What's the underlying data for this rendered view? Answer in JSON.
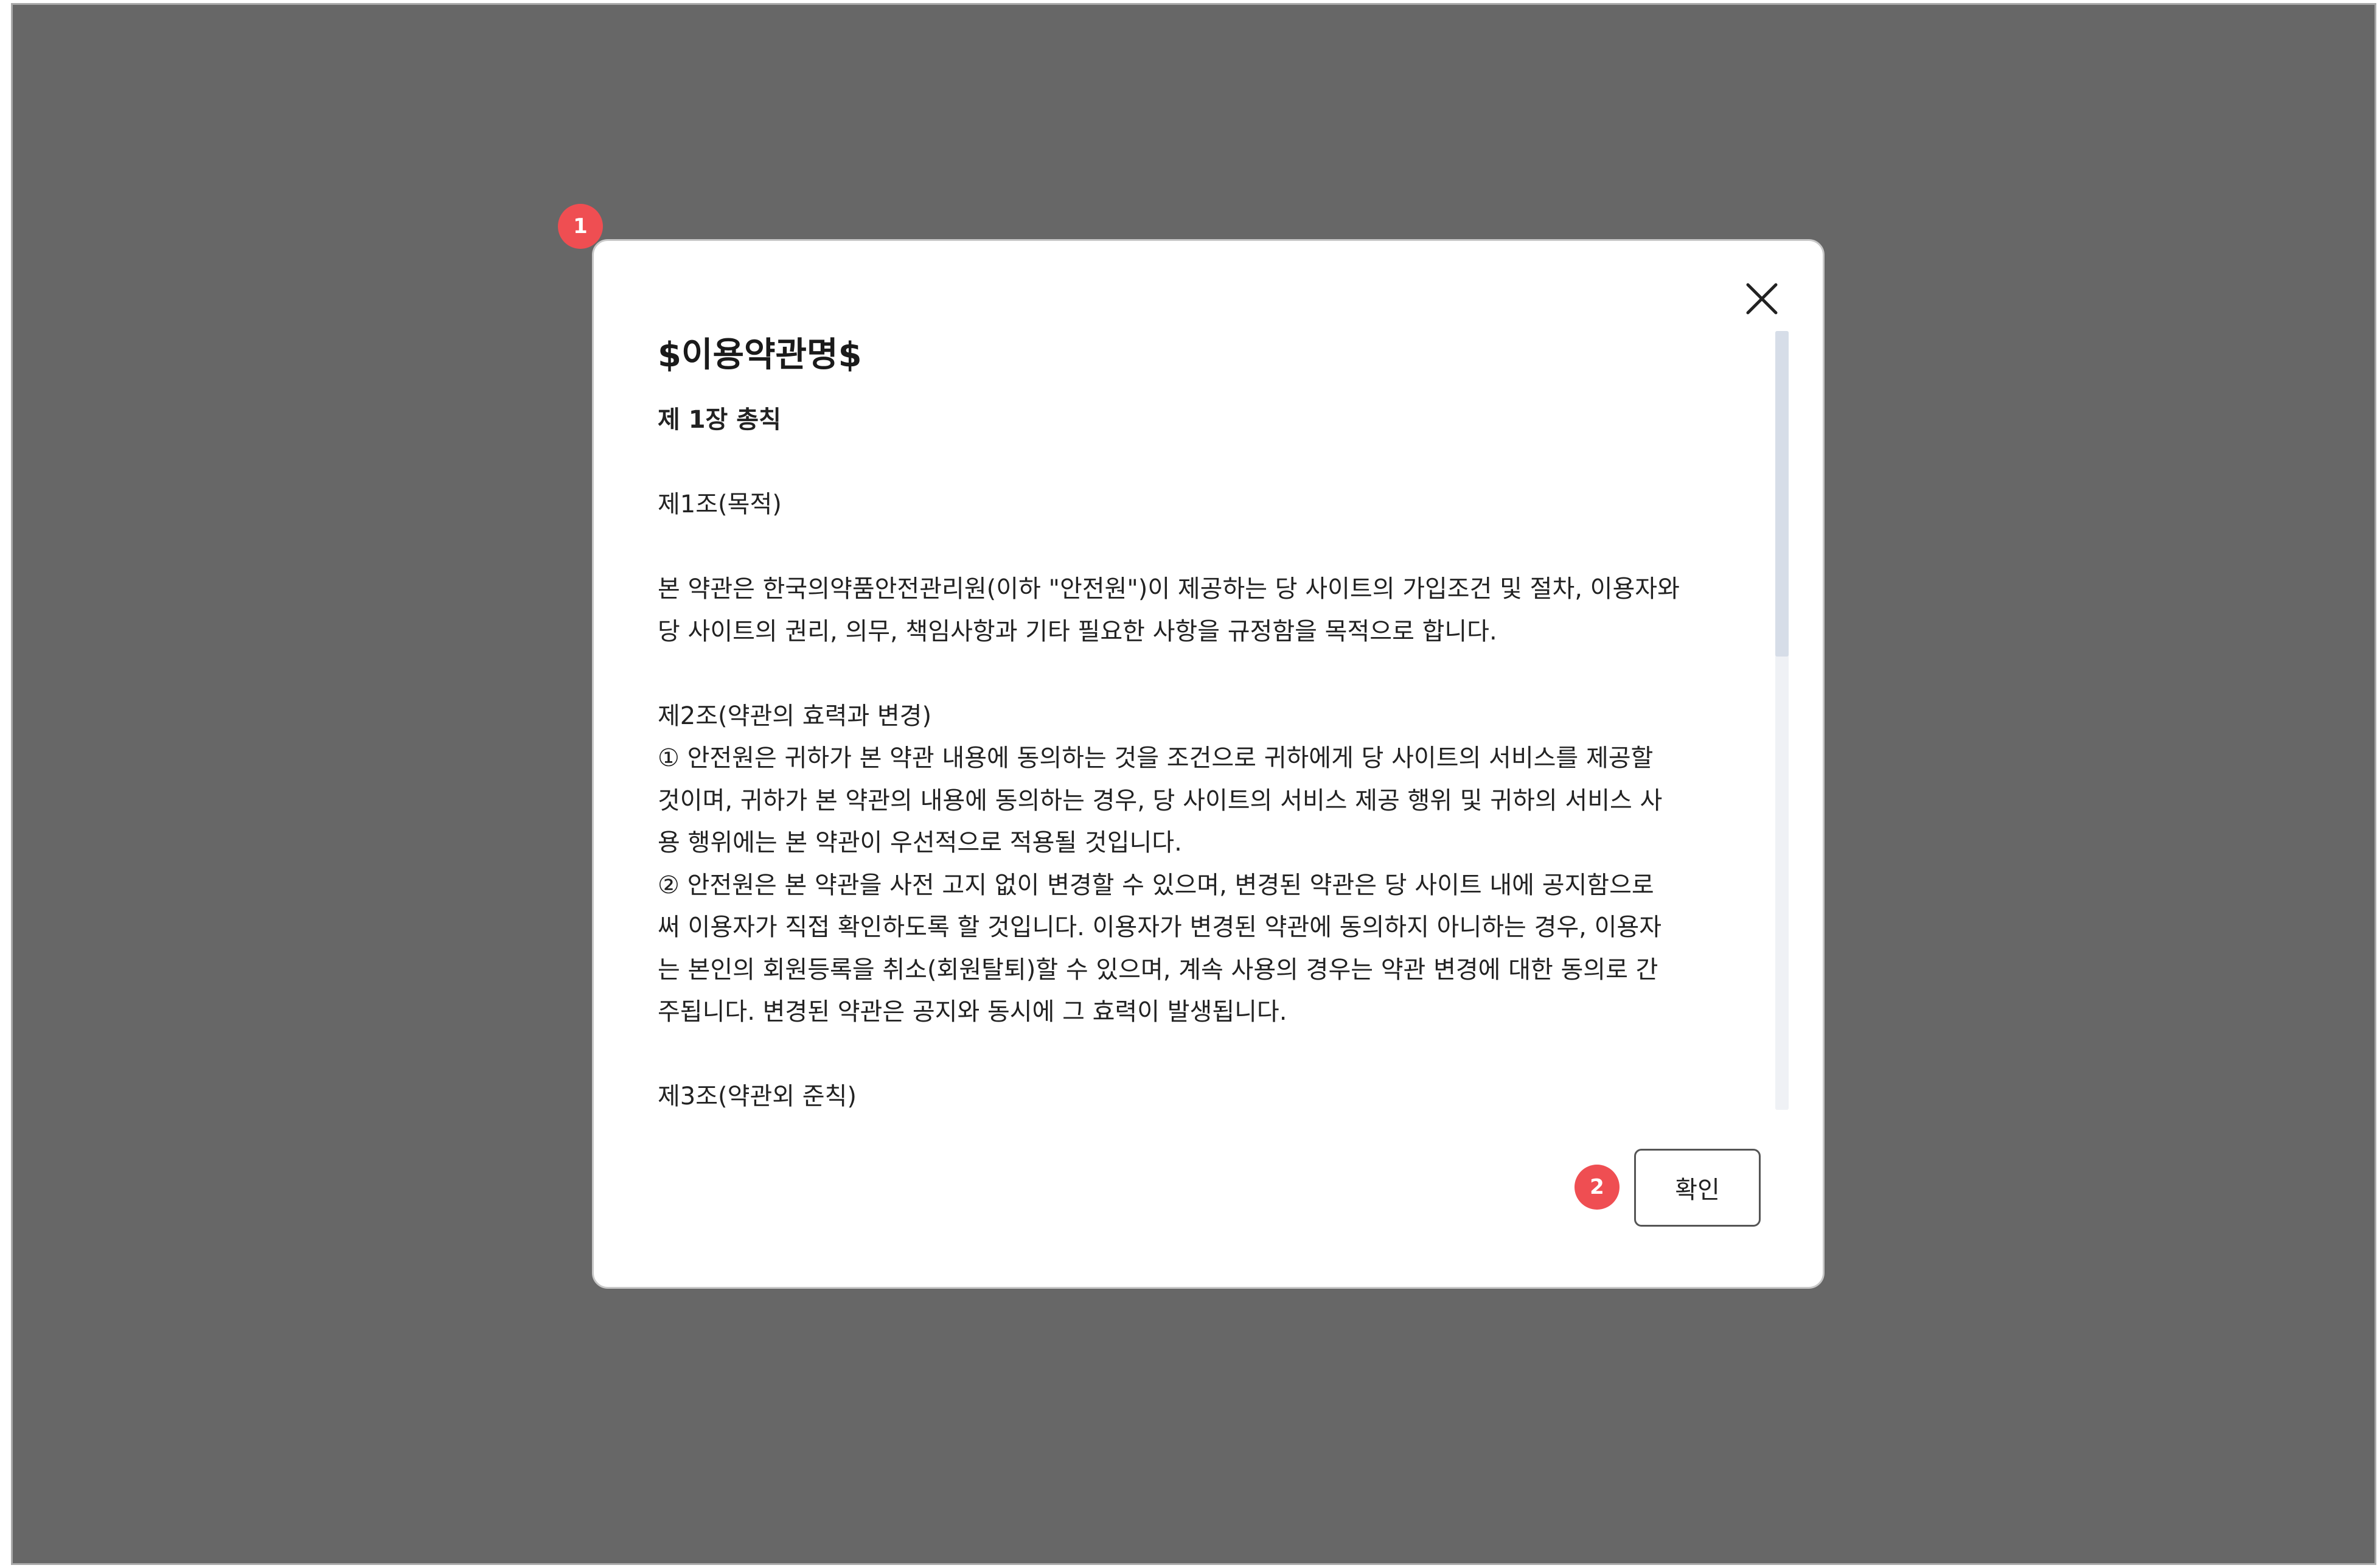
{
  "modal": {
    "title": "$이용약관명$",
    "close_icon": "close-icon",
    "confirm_label": "확인"
  },
  "terms": {
    "chapter1_title": "제 1장 총칙",
    "art1_title": "제1조(목적)",
    "art1_body_1": "본 약관은 한국의약품안전관리원(이하 \"안전원\")이 제공하는 당 사이트의 가입조건 및 절차, 이용자와",
    "art1_body_2": "당 사이트의 권리, 의무, 책임사항과 기타 필요한 사항을 규정함을 목적으로 합니다.",
    "art2_title": "제2조(약관의 효력과 변경)",
    "art2_line_1": "① 안전원은 귀하가 본 약관 내용에 동의하는 것을 조건으로 귀하에게 당 사이트의 서비스를 제공할",
    "art2_line_2": "것이며, 귀하가 본 약관의 내용에 동의하는 경우, 당 사이트의 서비스 제공 행위 및 귀하의 서비스 사",
    "art2_line_3": "용 행위에는 본 약관이 우선적으로 적용될 것입니다.",
    "art2_line_4": "② 안전원은 본 약관을 사전 고지 없이 변경할 수 있으며, 변경된 약관은 당 사이트 내에 공지함으로",
    "art2_line_5": "써 이용자가 직접 확인하도록 할 것입니다. 이용자가 변경된 약관에 동의하지 아니하는 경우, 이용자",
    "art2_line_6": "는 본인의 회원등록을 취소(회원탈퇴)할 수 있으며, 계속 사용의 경우는 약관 변경에 대한 동의로 간",
    "art2_line_7": "주됩니다. 변경된 약관은 공지와 동시에 그 효력이 발생됩니다.",
    "art3_title": "제3조(약관외 준칙)"
  },
  "annotations": {
    "marker_1": "1",
    "marker_2": "2"
  },
  "colors": {
    "backdrop": "#676767",
    "marker": "#ef4e52",
    "scroll_track": "#eff1f5",
    "scroll_thumb": "#d6dde8"
  }
}
